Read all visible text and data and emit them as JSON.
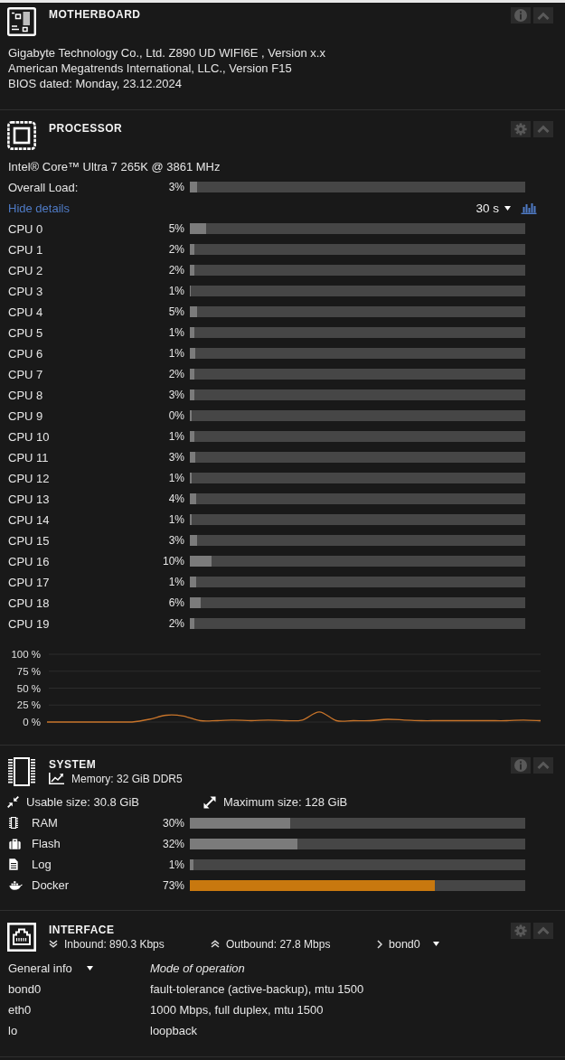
{
  "motherboard": {
    "title": "MOTHERBOARD",
    "controls": [
      {
        "kind": "info"
      },
      {
        "kind": "collapse"
      }
    ],
    "lines": [
      "Gigabyte Technology Co., Ltd. Z890 UD WIFI6E , Version x.x",
      "American Megatrends International, LLC., Version F15",
      "BIOS dated: Monday, 23.12.2024"
    ]
  },
  "processor": {
    "title": "PROCESSOR",
    "controls": [
      {
        "kind": "settings"
      },
      {
        "kind": "collapse"
      }
    ],
    "model": "Intel® Core™ Ultra 7 265K @ 3861 MHz",
    "overall": {
      "label": "Overall Load:",
      "reading": "3%",
      "level": 0.022
    },
    "details_link": "Hide details",
    "interval": "30 s",
    "cores": [
      {
        "name": "CPU 0",
        "reading": "5%",
        "level": 0.049
      },
      {
        "name": "CPU 1",
        "reading": "2%",
        "level": 0.013
      },
      {
        "name": "CPU 2",
        "reading": "2%",
        "level": 0.013
      },
      {
        "name": "CPU 3",
        "reading": "1%",
        "level": 0.004
      },
      {
        "name": "CPU 4",
        "reading": "5%",
        "level": 0.022
      },
      {
        "name": "CPU 5",
        "reading": "1%",
        "level": 0.013
      },
      {
        "name": "CPU 6",
        "reading": "1%",
        "level": 0.016
      },
      {
        "name": "CPU 7",
        "reading": "2%",
        "level": 0.013
      },
      {
        "name": "CPU 8",
        "reading": "3%",
        "level": 0.013
      },
      {
        "name": "CPU 9",
        "reading": "0%",
        "level": 0.005
      },
      {
        "name": "CPU 10",
        "reading": "1%",
        "level": 0.013
      },
      {
        "name": "CPU 11",
        "reading": "3%",
        "level": 0.016
      },
      {
        "name": "CPU 12",
        "reading": "1%",
        "level": 0.005
      },
      {
        "name": "CPU 13",
        "reading": "4%",
        "level": 0.019
      },
      {
        "name": "CPU 14",
        "reading": "1%",
        "level": 0.005
      },
      {
        "name": "CPU 15",
        "reading": "3%",
        "level": 0.022
      },
      {
        "name": "CPU 16",
        "reading": "10%",
        "level": 0.065
      },
      {
        "name": "CPU 17",
        "reading": "1%",
        "level": 0.019
      },
      {
        "name": "CPU 18",
        "reading": "6%",
        "level": 0.032
      },
      {
        "name": "CPU 19",
        "reading": "2%",
        "level": 0.013
      }
    ],
    "chart_data": {
      "type": "line",
      "grid": true,
      "ylim": [
        0,
        100
      ],
      "yticks": [
        {
          "value": 100,
          "label": "100 %"
        },
        {
          "value": 75,
          "label": "75 %"
        },
        {
          "value": 50,
          "label": "50 %"
        },
        {
          "value": 25,
          "label": "25 %"
        },
        {
          "value": 0,
          "label": "0 %"
        }
      ],
      "series": [
        {
          "color": "#c8742a",
          "values": [
            0,
            0,
            0,
            0,
            0,
            0,
            4,
            10,
            9,
            2,
            2,
            3,
            2,
            3,
            2,
            3,
            15,
            2,
            2,
            2,
            4,
            3,
            2,
            2,
            2,
            2,
            2,
            2,
            3,
            2
          ]
        }
      ]
    }
  },
  "system": {
    "title": "SYSTEM",
    "controls": [
      {
        "kind": "info"
      },
      {
        "kind": "collapse"
      }
    ],
    "memory": "Memory: 32 GiB DDR5",
    "usable": "Usable size: 30.8 GiB",
    "maximum": "Maximum size: 128 GiB",
    "usage": [
      {
        "kind": "ram",
        "name": "RAM",
        "reading": "30%",
        "level": 0.3,
        "alert": false
      },
      {
        "kind": "flash",
        "name": "Flash",
        "reading": "32%",
        "level": 0.32,
        "alert": false
      },
      {
        "kind": "log",
        "name": "Log",
        "reading": "1%",
        "level": 0.01,
        "alert": false
      },
      {
        "kind": "docker",
        "name": "Docker",
        "reading": "73%",
        "level": 0.73,
        "alert": true
      }
    ]
  },
  "interface": {
    "title": "INTERFACE",
    "controls": [
      {
        "kind": "settings"
      },
      {
        "kind": "collapse"
      }
    ],
    "inbound": "Inbound: 890.3 Kbps",
    "outbound": "Outbound: 27.8 Mbps",
    "port": "bond0",
    "table": {
      "view": "General info",
      "heading": "Mode of operation",
      "rows": [
        {
          "name": "bond0",
          "mode": "fault-tolerance (active-backup), mtu 1500"
        },
        {
          "name": "eth0",
          "mode": "1000 Mbps, full duplex, mtu 1500"
        },
        {
          "name": "lo",
          "mode": "loopback"
        }
      ]
    }
  }
}
